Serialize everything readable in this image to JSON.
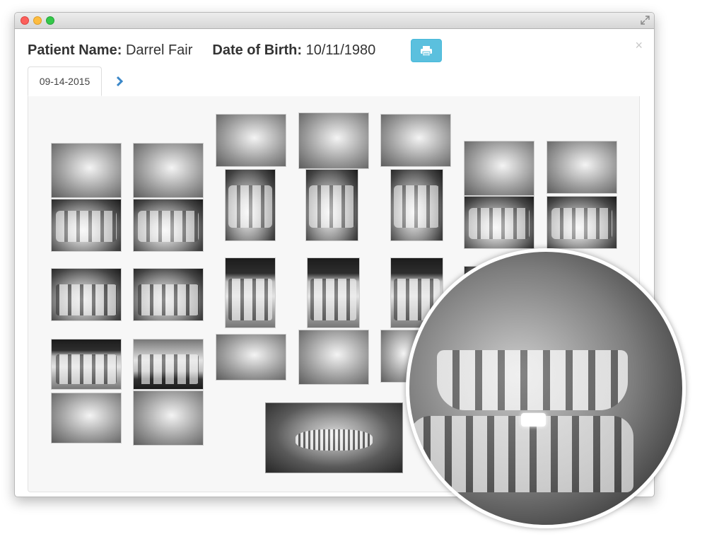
{
  "patient": {
    "name_label": "Patient Name:",
    "name_value": "Darrel Fair",
    "dob_label": "Date of Birth:",
    "dob_value": "10/11/1980"
  },
  "toolbar": {
    "print_icon": "printer-icon",
    "close_label": "×"
  },
  "tabs": [
    {
      "label": "09-14-2015",
      "active": true
    }
  ],
  "tab_next_icon": "chevron-right-icon",
  "colors": {
    "print_button": "#5bc0de",
    "tab_arrow": "#3a87c8"
  }
}
